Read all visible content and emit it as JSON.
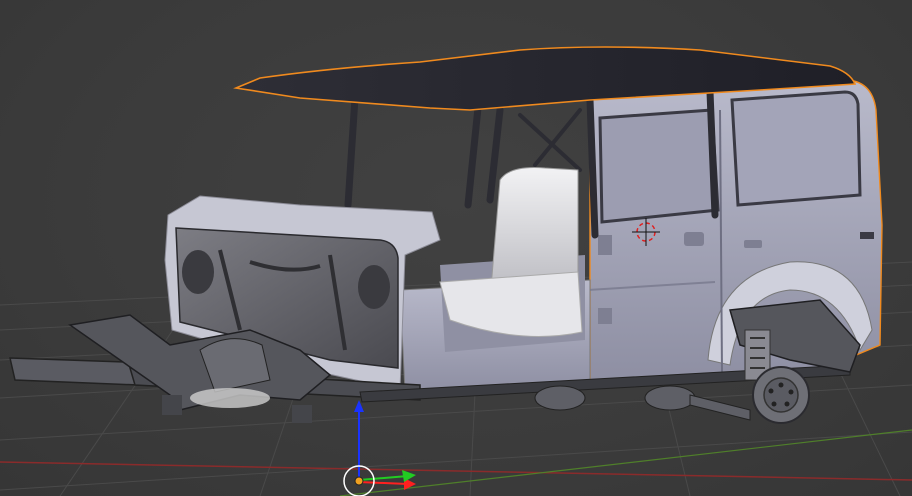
{
  "viewport": {
    "selection_outline_color": "#f08a1e",
    "grid_line_color": "#4a4a4a",
    "x_axis_color": "#8a2b2b",
    "y_axis_color": "#4f7f2a"
  },
  "scene": {
    "object": "jeep-body-model",
    "body_color": "#a9aabd",
    "roof_color": "#2a2a33",
    "chassis_color": "#4b4c52"
  },
  "gizmo": {
    "z_axis_color": "#1a33ff",
    "x_handle_color": "#ff2020",
    "y_handle_color": "#22cc22",
    "pivot_color": "#f0a020"
  },
  "cursor_3d": {
    "icon": "crosshair-cursor-icon"
  }
}
